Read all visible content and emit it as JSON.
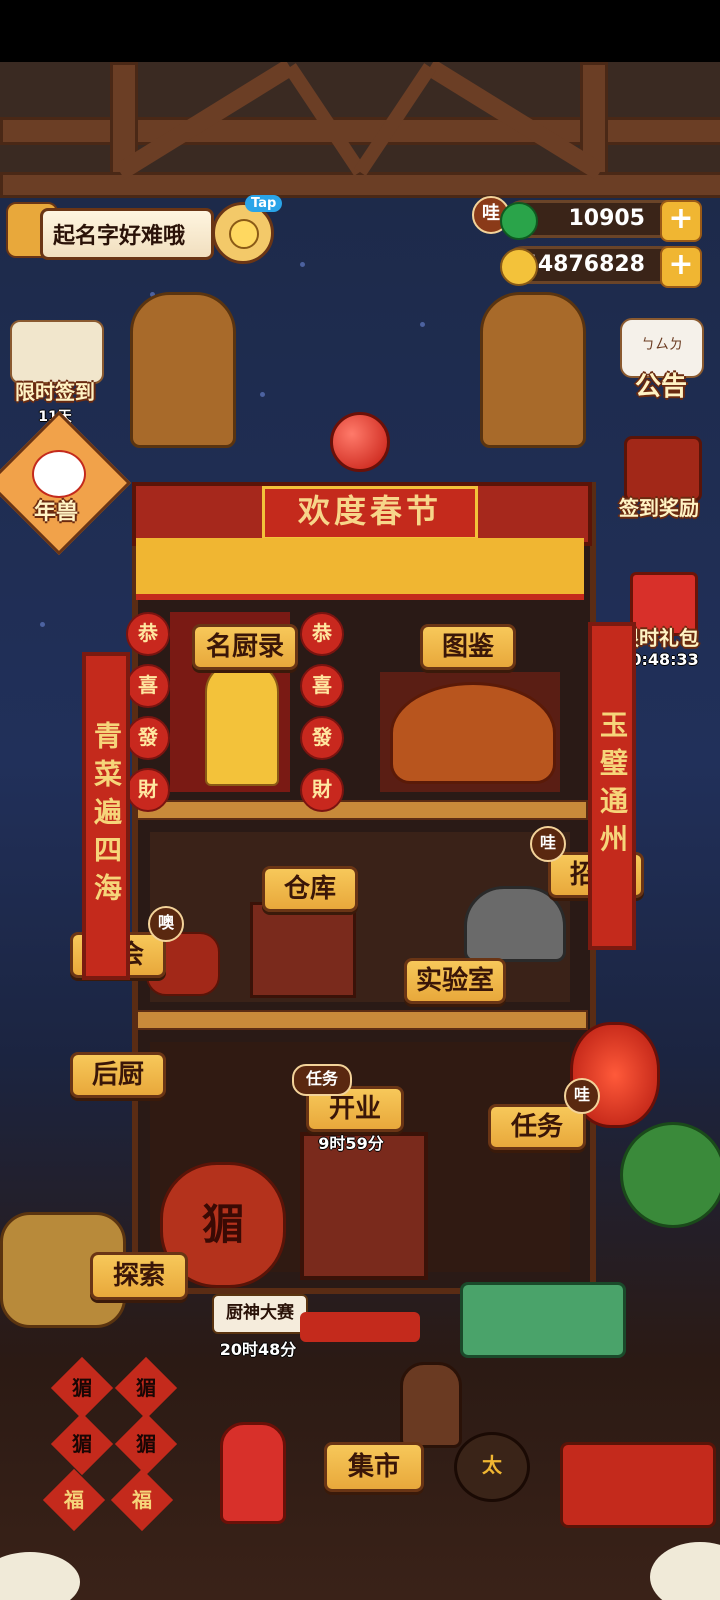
{
  "player": {
    "name": "起名字好难哦",
    "tap_label": "Tap"
  },
  "currency": {
    "gem_badge": "哇",
    "gems": "10905",
    "coins": "44876828",
    "plus": "+"
  },
  "left_menu": {
    "signin": {
      "label": "限时签到",
      "sub": "11天"
    },
    "nianshou": {
      "label": "年兽"
    }
  },
  "right_menu": {
    "notice": {
      "label": "公告",
      "icon_text": "ㄅㄙㄉ"
    },
    "signin_reward": {
      "label": "签到奖励"
    },
    "gift": {
      "label": "限时礼包",
      "timer": "10:48:33"
    }
  },
  "building": {
    "banner": "欢度春节",
    "lanterns_left": [
      "恭",
      "喜",
      "發",
      "財"
    ],
    "lanterns_right": [
      "恭",
      "喜",
      "發",
      "財"
    ],
    "couplet_left": "青菜遍四海",
    "couplet_right": "玉璧通州"
  },
  "rooms": {
    "chefs": "名厨录",
    "atlas": "图鉴",
    "warehouse": "仓库",
    "recruit": "招募",
    "recruit_badge": "哇",
    "banquet": "宴会",
    "banquet_badge": "噢",
    "lab": "实验室",
    "kitchen": "后厨",
    "open": "开业",
    "open_badge": "任务",
    "open_timer": "9时59分",
    "tasks": "任务",
    "tasks_badge": "哇",
    "explore": "探索",
    "contest": "厨神大赛",
    "contest_timer": "20时48分",
    "market": "集市"
  },
  "decor": {
    "jar_text": "猸",
    "fu": [
      "猸",
      "猸",
      "猸",
      "猸",
      "福",
      "福"
    ],
    "pot_text": "太"
  },
  "colors": {
    "label_bg": "#f0b84a",
    "label_border": "#6a3515",
    "red": "#c42a1c",
    "sky": "#21305a"
  }
}
